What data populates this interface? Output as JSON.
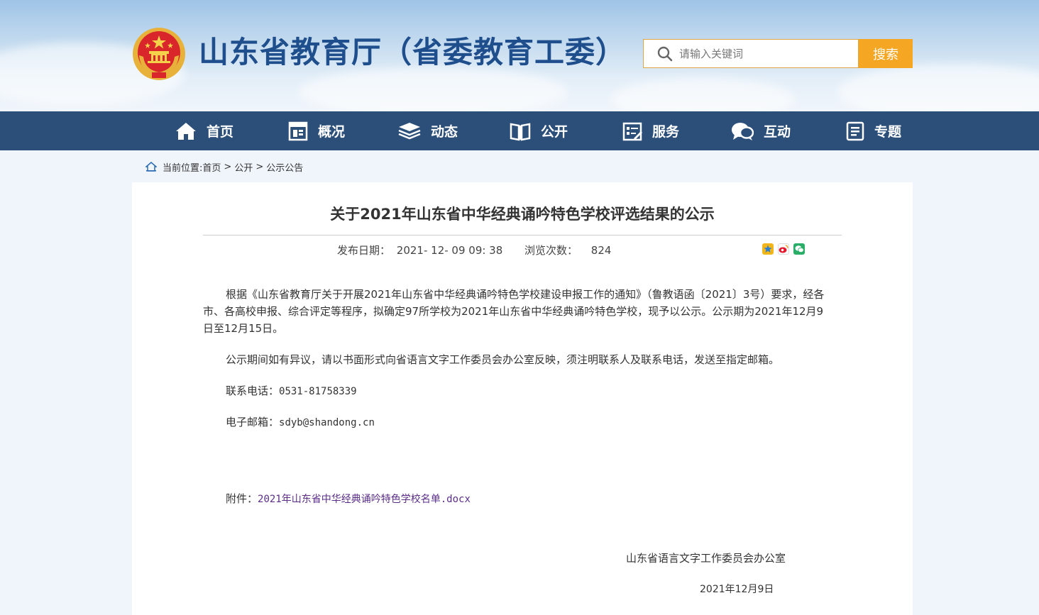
{
  "header": {
    "site_title": "山东省教育厅（省委教育工委）",
    "search_placeholder": "请输入关键词",
    "search_button": "搜索"
  },
  "nav": {
    "items": [
      {
        "label": "首页",
        "icon": "home-icon"
      },
      {
        "label": "概况",
        "icon": "overview-icon"
      },
      {
        "label": "动态",
        "icon": "news-stack-icon"
      },
      {
        "label": "公开",
        "icon": "book-icon"
      },
      {
        "label": "服务",
        "icon": "service-icon"
      },
      {
        "label": "互动",
        "icon": "chat-icon"
      },
      {
        "label": "专题",
        "icon": "document-icon"
      }
    ]
  },
  "breadcrumb": {
    "prefix": "当前位置:",
    "items": [
      "首页",
      "公开",
      "公示公告"
    ],
    "separator": ">"
  },
  "article": {
    "title": "关于2021年山东省中华经典诵吟特色学校评选结果的公示",
    "publish_label": "发布日期：",
    "publish_value": "2021- 12- 09 09: 38",
    "views_label": "浏览次数：",
    "views_value": "824",
    "share_icons": [
      "qzone-icon",
      "weibo-icon",
      "wechat-icon"
    ],
    "para1": "根据《山东省教育厅关于开展2021年山东省中华经典诵吟特色学校建设申报工作的通知》（鲁教语函〔2021〕3号）要求，经各市、各高校申报、综合评定等程序，拟确定97所学校为2021年山东省中华经典诵吟特色学校，现予以公示。公示期为2021年12月9日至12月15日。",
    "para2": "公示期间如有异议，请以书面形式向省语言文字工作委员会办公室反映，须注明联系人及联系电话，发送至指定邮箱。",
    "phone_label": "联系电话：",
    "phone_value": "0531-81758339",
    "email_label": "电子邮箱：",
    "email_value": "sdyb@shandong.cn",
    "attach_label": "附件：",
    "attach_link": "2021年山东省中华经典诵吟特色学校名单.docx",
    "signature": "山东省语言文字工作委员会办公室",
    "sign_date": "2021年12月9日"
  },
  "colors": {
    "nav_bg": "#2c4f7a",
    "title_blue": "#1f4e8c",
    "search_orange": "#f5a623",
    "link_purple": "#5b2d88"
  }
}
